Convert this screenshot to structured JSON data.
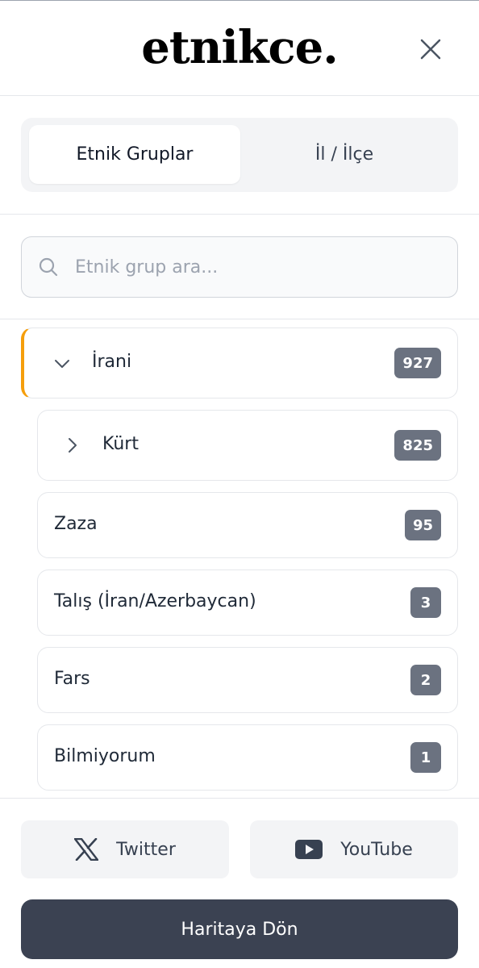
{
  "header": {
    "logo": "etnikce.",
    "close_icon": "close-icon"
  },
  "tabs": [
    {
      "label": "Etnik Gruplar",
      "active": true
    },
    {
      "label": "İl / İlçe",
      "active": false
    }
  ],
  "search": {
    "placeholder": "Etnik grup ara...",
    "value": "",
    "icon": "search-icon"
  },
  "groups": [
    {
      "label": "İrani",
      "count": "927",
      "expanded": true,
      "icon": "chevron-down-icon"
    },
    {
      "label": "Kürt",
      "count": "825",
      "expanded": false,
      "icon": "chevron-right-icon"
    },
    {
      "label": "Zaza",
      "count": "95"
    },
    {
      "label": "Talış (İran/Azerbaycan)",
      "count": "3"
    },
    {
      "label": "Fars",
      "count": "2"
    },
    {
      "label": "Bilmiyorum",
      "count": "1"
    }
  ],
  "footer": {
    "twitter_label": "Twitter",
    "youtube_label": "YouTube",
    "map_button_label": "Haritaya Dön"
  },
  "colors": {
    "accent": "#f59e0b",
    "badge": "#6b7280",
    "primary_button": "#3b4252"
  }
}
